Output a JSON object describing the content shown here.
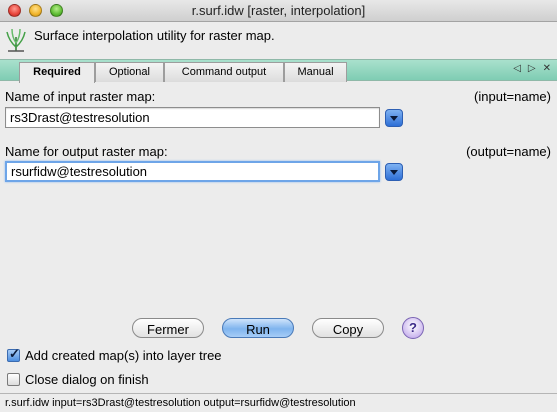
{
  "window": {
    "title": "r.surf.idw [raster, interpolation]"
  },
  "header": {
    "icon": "grass-module-icon",
    "description": "Surface interpolation utility for raster map."
  },
  "tabs": [
    {
      "label": "Required",
      "active": true
    },
    {
      "label": "Optional",
      "active": false
    },
    {
      "label": "Command output",
      "active": false
    },
    {
      "label": "Manual",
      "active": false
    }
  ],
  "tab_nav": {
    "prev": "◁",
    "next": "▷",
    "close": "✕"
  },
  "fields": {
    "input": {
      "label": "Name of input raster map:",
      "param": "(input=name)",
      "value": "rs3Drast@testresolution"
    },
    "output": {
      "label": "Name for output raster map:",
      "param": "(output=name)",
      "value": "rsurfidw@testresolution"
    }
  },
  "buttons": {
    "close": "Fermer",
    "run": "Run",
    "copy": "Copy",
    "help": "?"
  },
  "options": {
    "add_to_tree": {
      "label": "Add created map(s) into layer tree",
      "checked": true
    },
    "close_on_finish": {
      "label": "Close dialog on finish",
      "checked": false
    }
  },
  "status": {
    "command": "r.surf.idw input=rs3Drast@testresolution output=rsurfidw@testresolution"
  },
  "colors": {
    "tabbar": "#7fcdb3",
    "default_button": "#7fb4ee",
    "focus_ring": "#6ea5e8"
  }
}
